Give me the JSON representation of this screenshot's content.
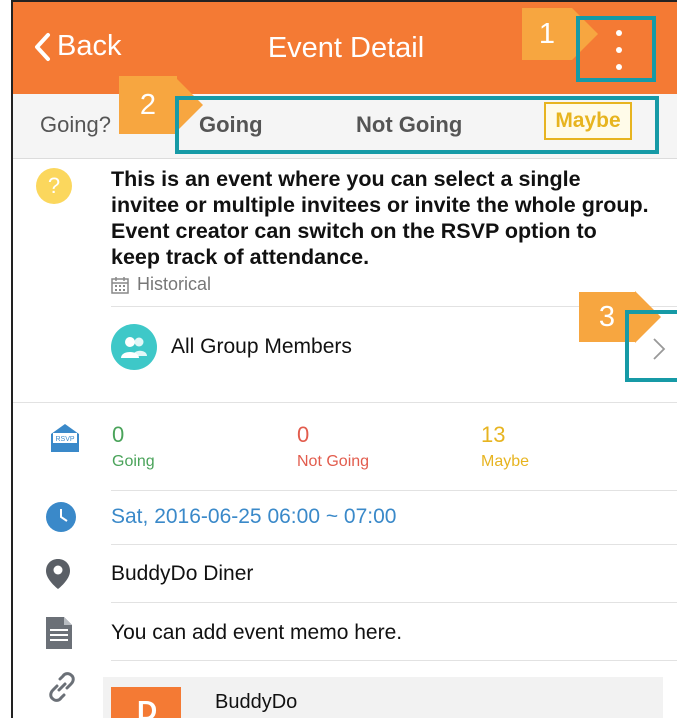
{
  "header": {
    "back_label": "Back",
    "title": "Event Detail"
  },
  "callouts": [
    "1",
    "2",
    "3"
  ],
  "rsvp": {
    "prompt": "Going?",
    "options": [
      "Going",
      "Not Going",
      "Maybe"
    ],
    "selected": "Maybe"
  },
  "event": {
    "description": "This is an event where you can select a single invitee or multiple invitees or invite the whole group. Event creator can switch on the RSVP option to keep track of attendance.",
    "status": "Historical",
    "invitees": "All Group Members",
    "rsvp_icon_text": "RSVP",
    "stats": [
      {
        "count": "0",
        "label": "Going",
        "color": "#4aa35a"
      },
      {
        "count": "0",
        "label": "Not Going",
        "color": "#e25c4d"
      },
      {
        "count": "13",
        "label": "Maybe",
        "color": "#e7b420"
      }
    ],
    "datetime": "Sat, 2016-06-25 06:00 ~ 07:00",
    "location": "BuddyDo Diner",
    "memo": "You can add event memo here.",
    "link_title": "BuddyDo",
    "link_thumb_text": "D"
  },
  "colors": {
    "header_bg": "#f47a34",
    "callout": "#f7a640",
    "highlight": "#169aa6",
    "datetime_text": "#3a89c9"
  },
  "icons": [
    "chevron-left-icon",
    "more-vertical-icon",
    "question-icon",
    "calendar-icon",
    "group-icon",
    "chevron-right-icon",
    "rsvp-envelope-icon",
    "clock-icon",
    "location-pin-icon",
    "memo-icon",
    "link-icon"
  ]
}
